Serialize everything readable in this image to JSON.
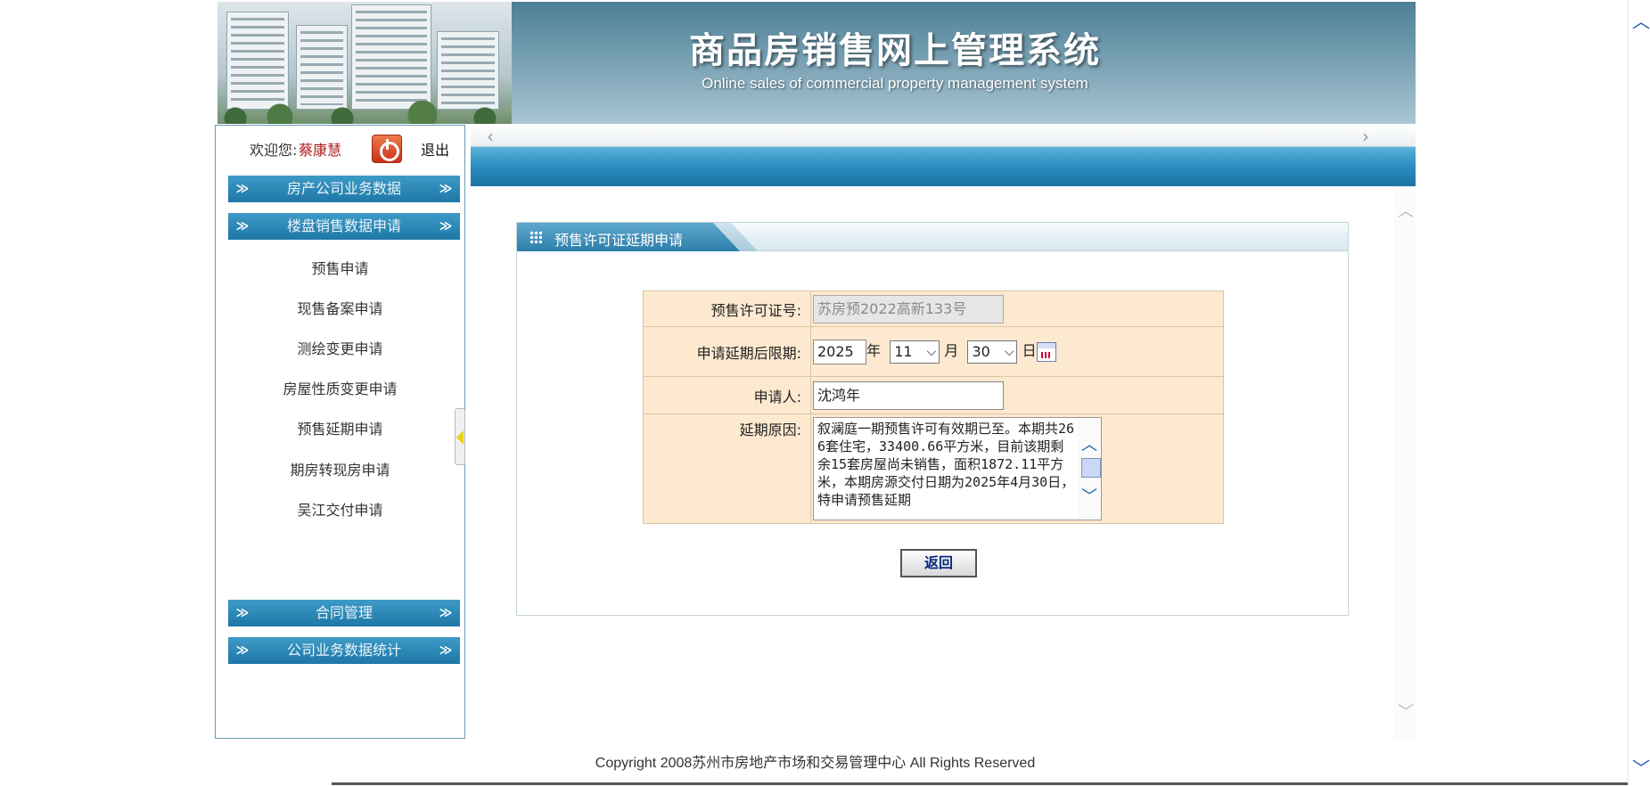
{
  "banner": {
    "title_cn": "商品房销售网上管理系统",
    "title_en": "Online sales of commercial property management system"
  },
  "sidebar": {
    "welcome_label": "欢迎您:",
    "user_name": "蔡康慧",
    "logout_label": "退出",
    "sections": [
      {
        "label": "房产公司业务数据"
      },
      {
        "label": "楼盘销售数据申请"
      },
      {
        "label": "合同管理"
      },
      {
        "label": "公司业务数据统计"
      }
    ],
    "items": [
      {
        "label": "预售申请"
      },
      {
        "label": "现售备案申请"
      },
      {
        "label": "测绘变更申请"
      },
      {
        "label": "房屋性质变更申请"
      },
      {
        "label": "预售延期申请"
      },
      {
        "label": "期房转现房申请"
      },
      {
        "label": "吴江交付申请"
      }
    ]
  },
  "panel": {
    "title": "预售许可证延期申请",
    "fields": {
      "permit_label": "预售许可证号:",
      "permit_value": "苏房预2022高新133号",
      "deadline_label": "申请延期后限期:",
      "year_value": "2025",
      "year_unit": "年",
      "month_value": "11",
      "month_unit": "月",
      "day_value": "30",
      "day_unit": "日",
      "applicant_label": "申请人:",
      "applicant_value": "沈鸿年",
      "reason_label": "延期原因:",
      "reason_value": "叙澜庭一期预售许可有效期已至。本期共266套住宅，33400.66平方米，目前该期剩余15套房屋尚未销售，面积1872.11平方米，本期房源交付日期为2025年4月30日，特申请预售延期"
    },
    "back_button": "返回"
  },
  "footer": {
    "copyright": "Copyright 2008苏州市房地产市场和交易管理中心  All Rights Reserved"
  },
  "icons": {
    "power": "power-icon",
    "expand": "double-chevron-down-icon",
    "calendar": "calendar-icon"
  }
}
